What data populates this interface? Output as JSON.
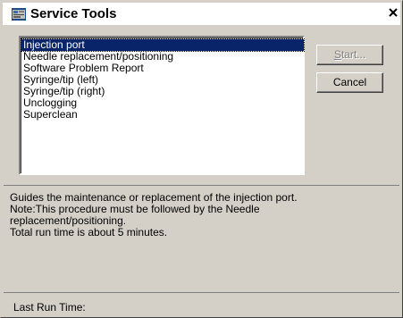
{
  "window": {
    "title": "Service Tools",
    "close_glyph": "✕",
    "icon": "service-tools-app-icon"
  },
  "procedures": [
    {
      "label": "Injection port",
      "selected": true
    },
    {
      "label": "Needle replacement/positioning",
      "selected": false
    },
    {
      "label": "Software Problem Report",
      "selected": false
    },
    {
      "label": "Syringe/tip (left)",
      "selected": false
    },
    {
      "label": "Syringe/tip (right)",
      "selected": false
    },
    {
      "label": "Unclogging",
      "selected": false
    },
    {
      "label": "Superclean",
      "selected": false
    }
  ],
  "buttons": {
    "start_label": "Start...",
    "start_enabled": false,
    "cancel_label": "Cancel"
  },
  "description": "Guides the maintenance or replacement of the injection port.\nNote:This procedure must be followed by the Needle\nreplacement/positioning.\nTotal run time is about 5 minutes.",
  "status": {
    "last_run_label": "Last Run Time:"
  },
  "colors": {
    "selection_bg": "#0a246a",
    "dialog_bg": "#d4d0c8"
  }
}
